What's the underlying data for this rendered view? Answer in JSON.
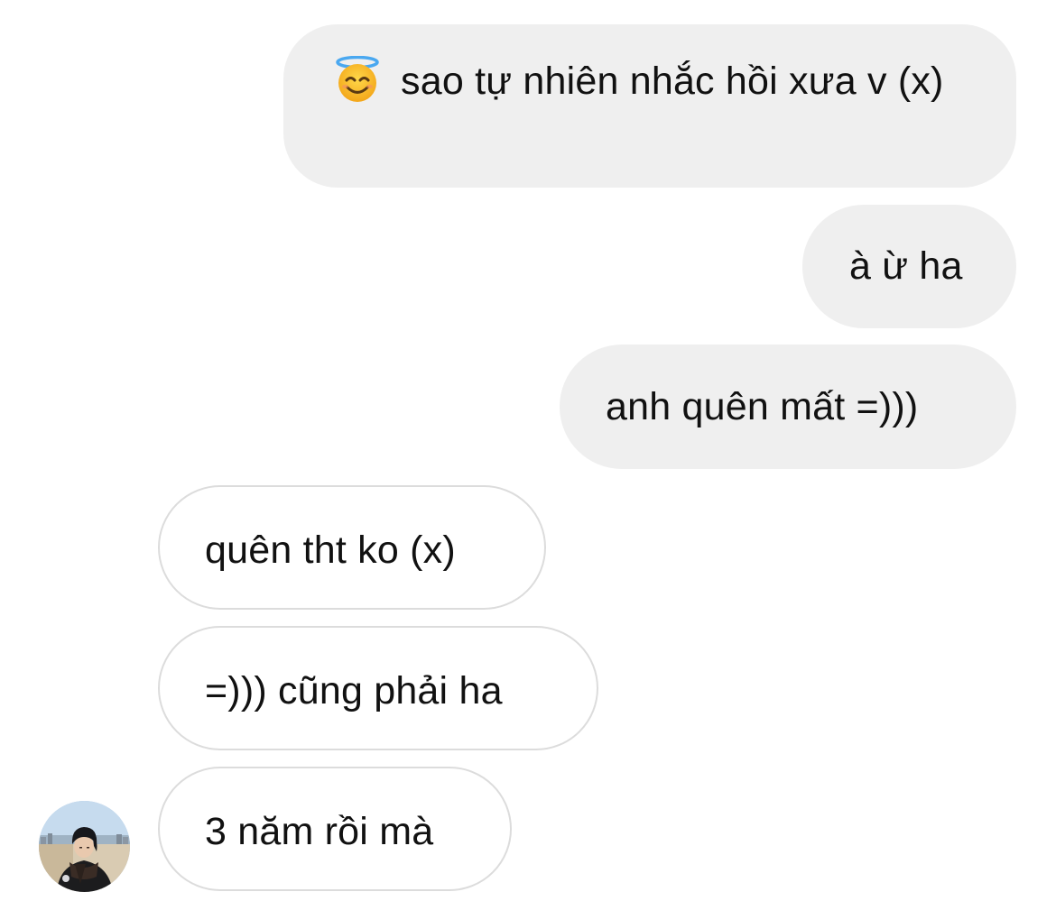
{
  "messages": [
    {
      "direction": "sent",
      "emoji": "smiling-face-with-halo",
      "text": "sao tự nhiên nhắc hồi xưa v (x)"
    },
    {
      "direction": "sent",
      "text": "à ừ ha"
    },
    {
      "direction": "sent",
      "text": "anh quên mất =)))"
    },
    {
      "direction": "received",
      "text": "quên tht ko (x)"
    },
    {
      "direction": "received",
      "text": "=))) cũng phải ha"
    },
    {
      "direction": "received",
      "text": "3 năm rồi mà"
    }
  ],
  "colors": {
    "sent_bubble": "#efefef",
    "received_border": "#dcdcdc",
    "text": "#111111",
    "background": "#ffffff"
  }
}
